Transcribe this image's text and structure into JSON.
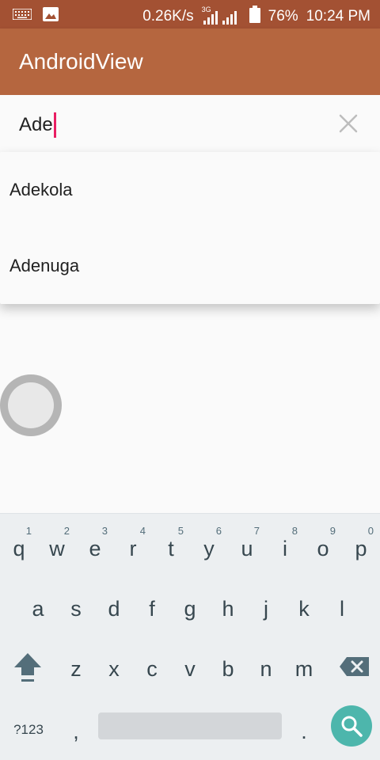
{
  "status_bar": {
    "net_speed": "0.26K/s",
    "network_type": "3G",
    "battery": "76%",
    "time": "10:24 PM",
    "icons": [
      "keyboard-icon",
      "image-icon",
      "signal-icon",
      "battery-icon"
    ]
  },
  "app_bar": {
    "title": "AndroidView"
  },
  "search": {
    "value": "Ade",
    "clear_icon": "close-icon"
  },
  "suggestions": [
    "Adekola",
    "Adenuga"
  ],
  "keyboard": {
    "row1": [
      {
        "ch": "q",
        "hint": "1"
      },
      {
        "ch": "w",
        "hint": "2"
      },
      {
        "ch": "e",
        "hint": "3"
      },
      {
        "ch": "r",
        "hint": "4"
      },
      {
        "ch": "t",
        "hint": "5"
      },
      {
        "ch": "y",
        "hint": "6"
      },
      {
        "ch": "u",
        "hint": "7"
      },
      {
        "ch": "i",
        "hint": "8"
      },
      {
        "ch": "o",
        "hint": "9"
      },
      {
        "ch": "p",
        "hint": "0"
      }
    ],
    "row2": [
      "a",
      "s",
      "d",
      "f",
      "g",
      "h",
      "j",
      "k",
      "l"
    ],
    "row3": [
      "z",
      "x",
      "c",
      "v",
      "b",
      "n",
      "m"
    ],
    "symbols_label": "?123",
    "comma": ",",
    "period": ".",
    "shift_icon": "shift-icon",
    "backspace_icon": "backspace-icon",
    "search_icon": "search-icon"
  },
  "colors": {
    "status_bar": "#a35133",
    "app_bar": "#b5663f",
    "caret": "#e91e63",
    "keyboard_bg": "#eceff1",
    "search_key": "#4db6ac"
  }
}
